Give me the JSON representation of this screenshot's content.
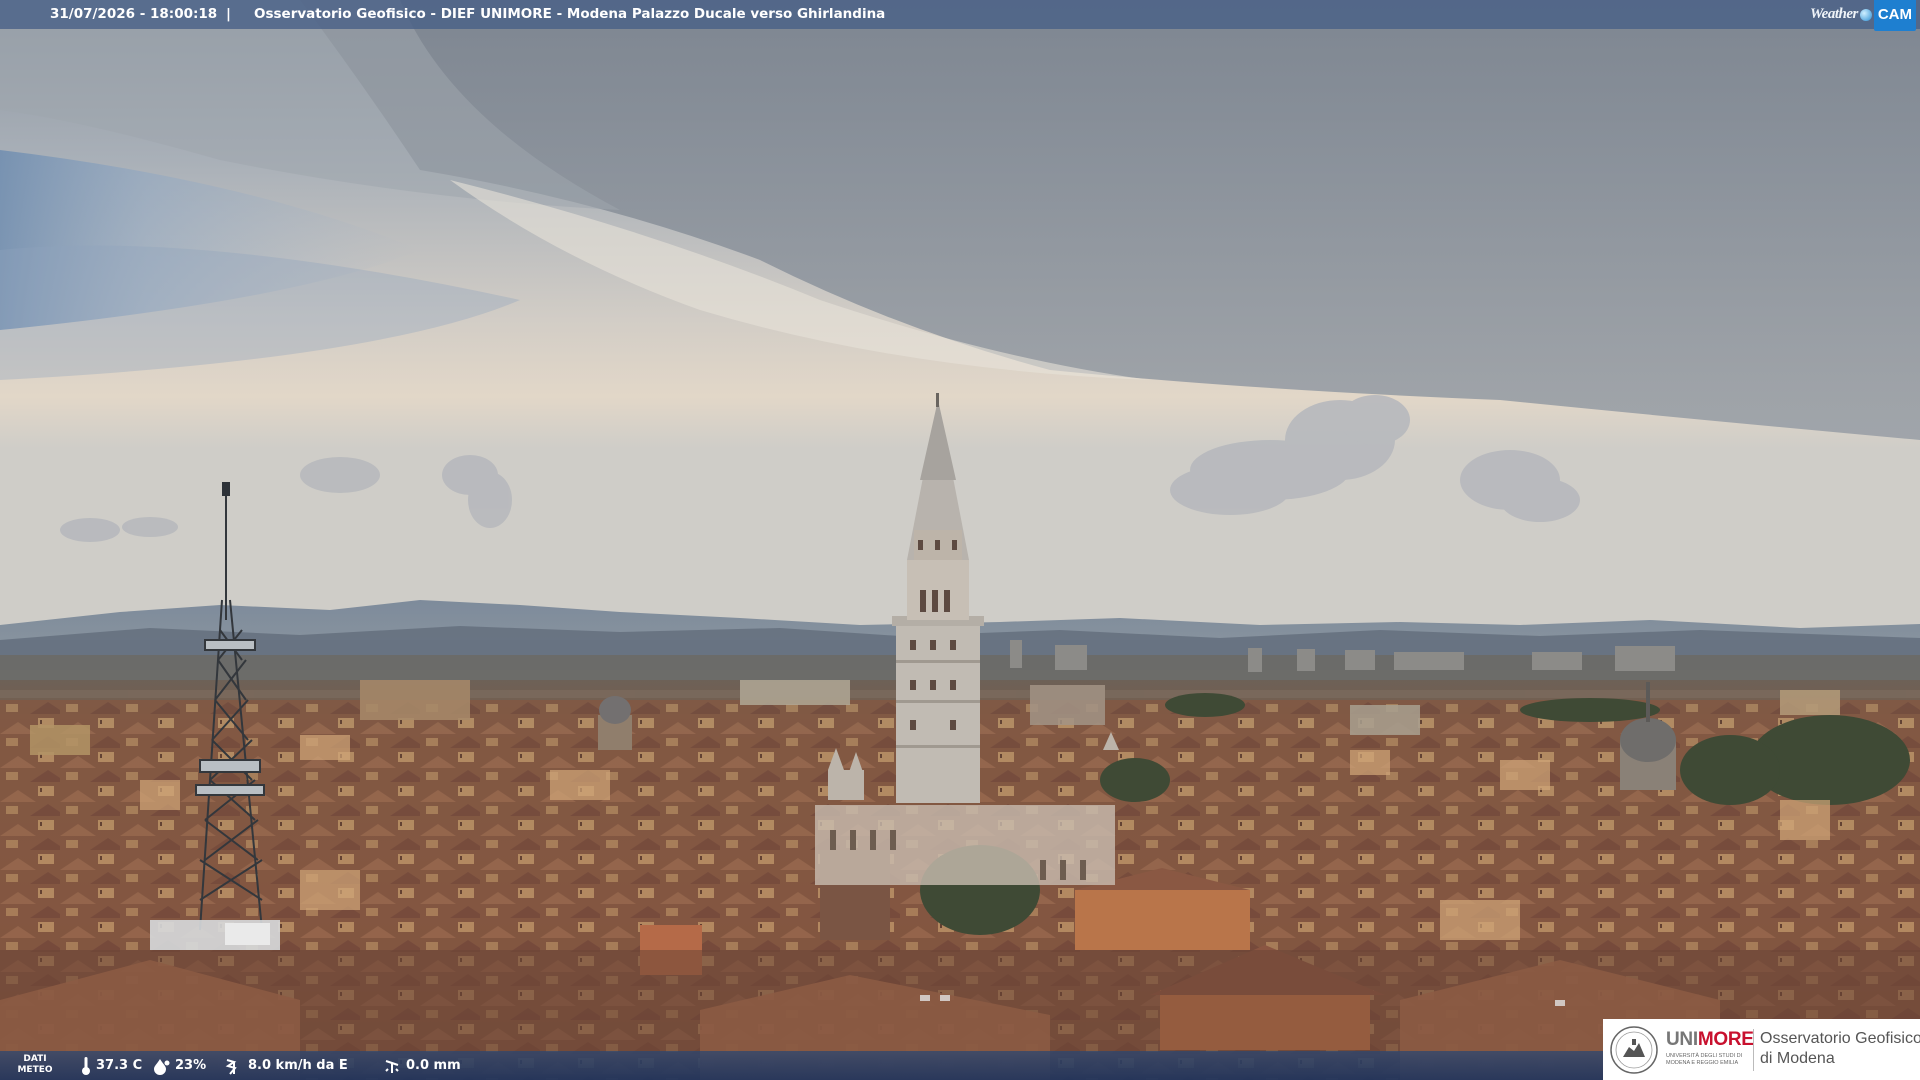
{
  "overlay": {
    "timestamp": "31/07/2026 - 18:00:18",
    "separator": "|",
    "location": "Osservatorio Geofisico - DIEF UNIMORE - Modena Palazzo Ducale verso Ghirlandina",
    "brand_weather": "Weather",
    "brand_cam": "CAM"
  },
  "meteo": {
    "label_line1": "DATI",
    "label_line2": "METEO",
    "temperature": "37.3 C",
    "humidity": "23%",
    "wind": "8.0 km/h da E",
    "rain": "0.0 mm"
  },
  "logo": {
    "uni_prefix": "UNI",
    "uni_suffix": "MORE",
    "uni_subtitle": "UNIVERSITÀ DEGLI STUDI DI MODENA E REGGIO EMILIA",
    "observatory_line1": "Osservatorio Geofisico",
    "observatory_line2": "di Modena"
  },
  "colors": {
    "sky_top": "#8e98a4",
    "sky_warm": "#e3d3bf",
    "roofs": "#8a5a40",
    "tower": "#c9c3ba",
    "topbar": "#465f87",
    "cam_badge": "#1e7fd0",
    "unimore_red": "#c8102e"
  },
  "icons": [
    "thermometer-icon",
    "humidity-drop-icon",
    "wind-icon",
    "rain-gauge-icon",
    "weathercam-logo-icon",
    "unimore-seal-icon"
  ]
}
